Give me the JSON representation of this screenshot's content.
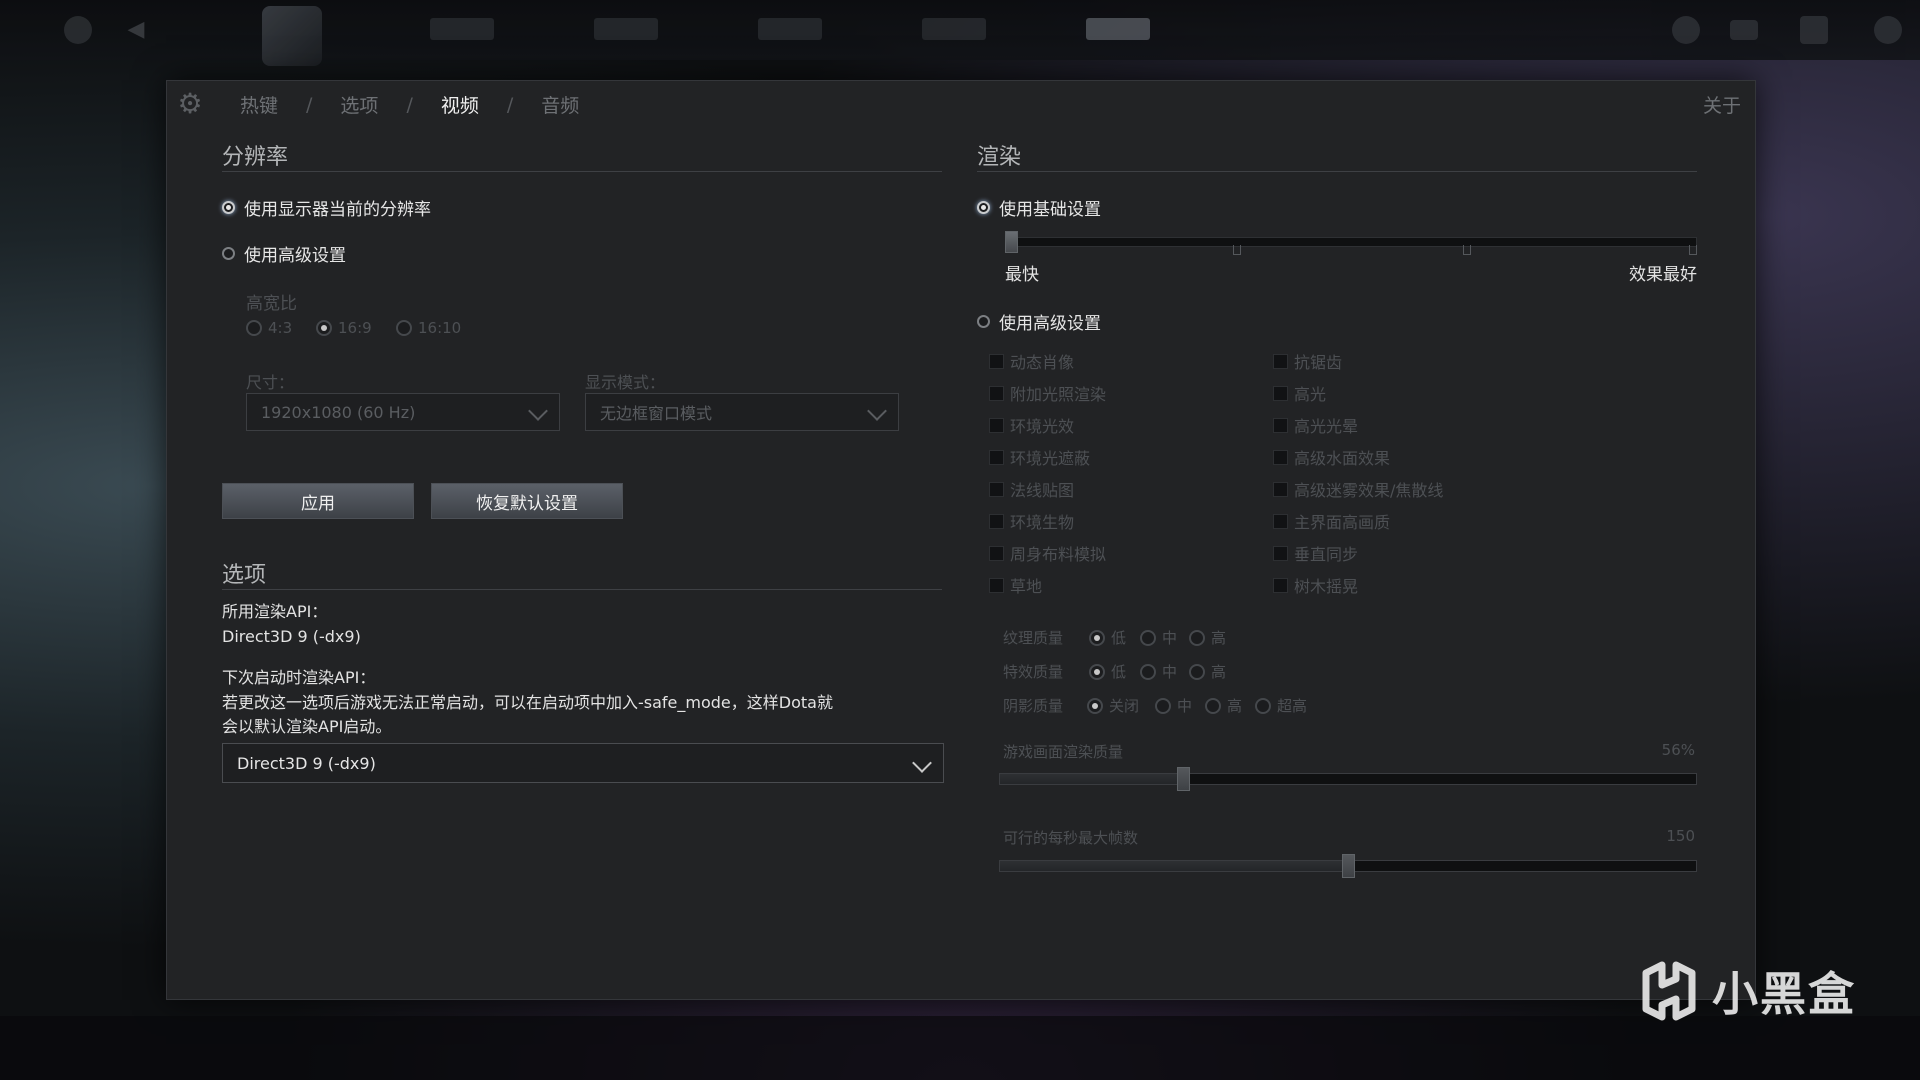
{
  "nav": {
    "tabs": [
      {
        "label": "热键",
        "active": false
      },
      {
        "label": "选项",
        "active": false
      },
      {
        "label": "视频",
        "active": true
      },
      {
        "label": "音频",
        "active": false
      }
    ],
    "separator": "/",
    "about": "关于"
  },
  "resolution": {
    "title": "分辨率",
    "use_current": "使用显示器当前的分辨率",
    "use_current_selected": true,
    "use_advanced": "使用高级设置",
    "aspect_label": "高宽比",
    "aspect_options": [
      {
        "label": "4:3",
        "selected": false
      },
      {
        "label": "16:9",
        "selected": true
      },
      {
        "label": "16:10",
        "selected": false
      }
    ],
    "size_label": "尺寸：",
    "size_value": "1920x1080 (60 Hz)",
    "mode_label": "显示模式：",
    "mode_value": "无边框窗口模式",
    "apply_button": "应用",
    "reset_button": "恢复默认设置"
  },
  "options": {
    "title": "选项",
    "api_label": "所用渲染API：",
    "api_value": "Direct3D 9 (-dx9)",
    "next_label": "下次启动时渲染API：",
    "next_note_line1": "若更改这一选项后游戏无法正常启动，可以在启动项中加入-safe_mode，这样Dota就",
    "next_note_line2": "会以默认渲染API启动。",
    "next_value": "Direct3D 9 (-dx9)"
  },
  "render": {
    "title": "渲染",
    "basic": "使用基础设置",
    "basic_selected": true,
    "basic_level": 0,
    "slider_min_label": "最快",
    "slider_max_label": "效果最好",
    "advanced": "使用高级设置",
    "checkboxes_left": [
      "动态肖像",
      "附加光照渲染",
      "环境光效",
      "环境光遮蔽",
      "法线贴图",
      "环境生物",
      "周身布料模拟",
      "草地"
    ],
    "checkboxes_right": [
      "抗锯齿",
      "高光",
      "高光光晕",
      "高级水面效果",
      "高级迷雾效果/焦散线",
      "主界面高画质",
      "垂直同步",
      "树木摇晃"
    ],
    "texture_label": "纹理质量",
    "texture_options": [
      "低",
      "中",
      "高"
    ],
    "effects_label": "特效质量",
    "effects_options": [
      "低",
      "中",
      "高"
    ],
    "shadow_label": "阴影质量",
    "shadow_options": [
      "关闭",
      "中",
      "高",
      "超高"
    ],
    "render_quality_label": "游戏画面渲染质量",
    "render_quality_value": "56%",
    "render_quality_fraction": 0.26,
    "fps_label": "可行的每秒最大帧数",
    "fps_value": "150",
    "fps_fraction": 0.5
  },
  "watermark": "小黑盒",
  "colors": {
    "panel": "#222325",
    "accent": "#c9cbcd",
    "dim": "#4d5054"
  }
}
